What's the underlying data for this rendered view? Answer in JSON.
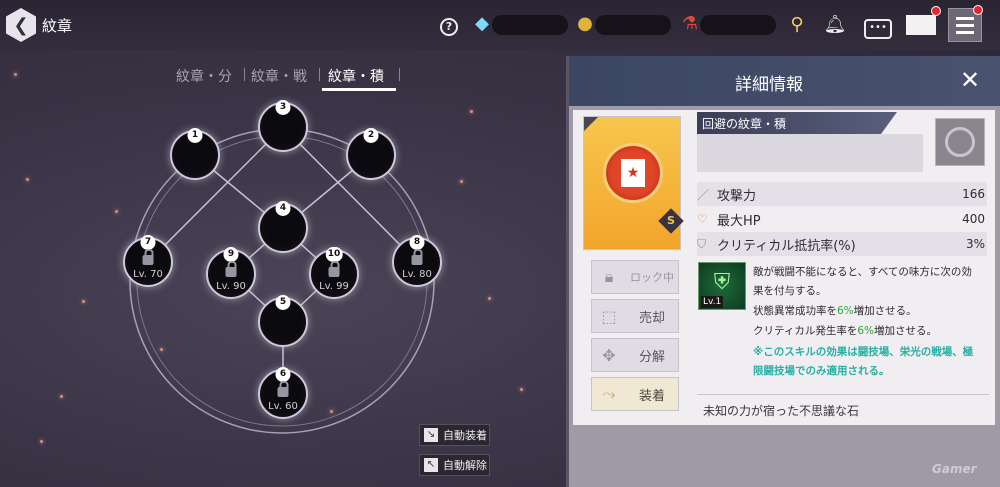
{
  "header": {
    "title": "紋章",
    "back_icon": "chevron-left-icon"
  },
  "tabs": [
    {
      "label": "紋章・分"
    },
    {
      "label": "紋章・戦"
    },
    {
      "label": "紋章・積",
      "active": true
    }
  ],
  "nodes": [
    {
      "num": "1"
    },
    {
      "num": "2"
    },
    {
      "num": "3"
    },
    {
      "num": "4"
    },
    {
      "num": "5"
    },
    {
      "num": "6",
      "level": "Lv. 60"
    },
    {
      "num": "7",
      "level": "Lv. 70"
    },
    {
      "num": "8",
      "level": "Lv. 80"
    },
    {
      "num": "9",
      "level": "Lv. 90"
    },
    {
      "num": "10",
      "level": "Lv. 99"
    }
  ],
  "auto": {
    "equip": "自動装着",
    "unequip": "自動解除"
  },
  "panel": {
    "title": "詳細情報",
    "item_name": "回避の紋章・積",
    "grade": "S",
    "stats": [
      {
        "label": "攻撃力",
        "value": "166"
      },
      {
        "label": "最大HP",
        "value": "400"
      },
      {
        "label": "クリティカル抵抗率(%)",
        "value": "3%"
      }
    ],
    "buttons": {
      "lock": "ロック中",
      "sell": "売却",
      "disassemble": "分解",
      "equip": "装着"
    },
    "skill": {
      "level": "Lv.1",
      "line1": "敵が戦闘不能になると、すべての味方に次の効",
      "line2": "果を付与する。",
      "line3a": "状態異常成功率を",
      "line3b": "6%",
      "line3c": "増加させる。",
      "line4a": "クリティカル発生率を",
      "line4b": "6%",
      "line4c": "増加させる。",
      "note1": "※このスキルの効果は闘技場、栄光の戦場、極",
      "note2": "限闘技場でのみ適用される。"
    },
    "flavor": "未知の力が宿った不思議な石"
  },
  "watermark": "Gamer",
  "colors": {
    "accent_green": "#2aa53a",
    "note_teal": "#27b0a3",
    "panel_header": "#3b4663",
    "item_bg": "#f2a52b"
  }
}
